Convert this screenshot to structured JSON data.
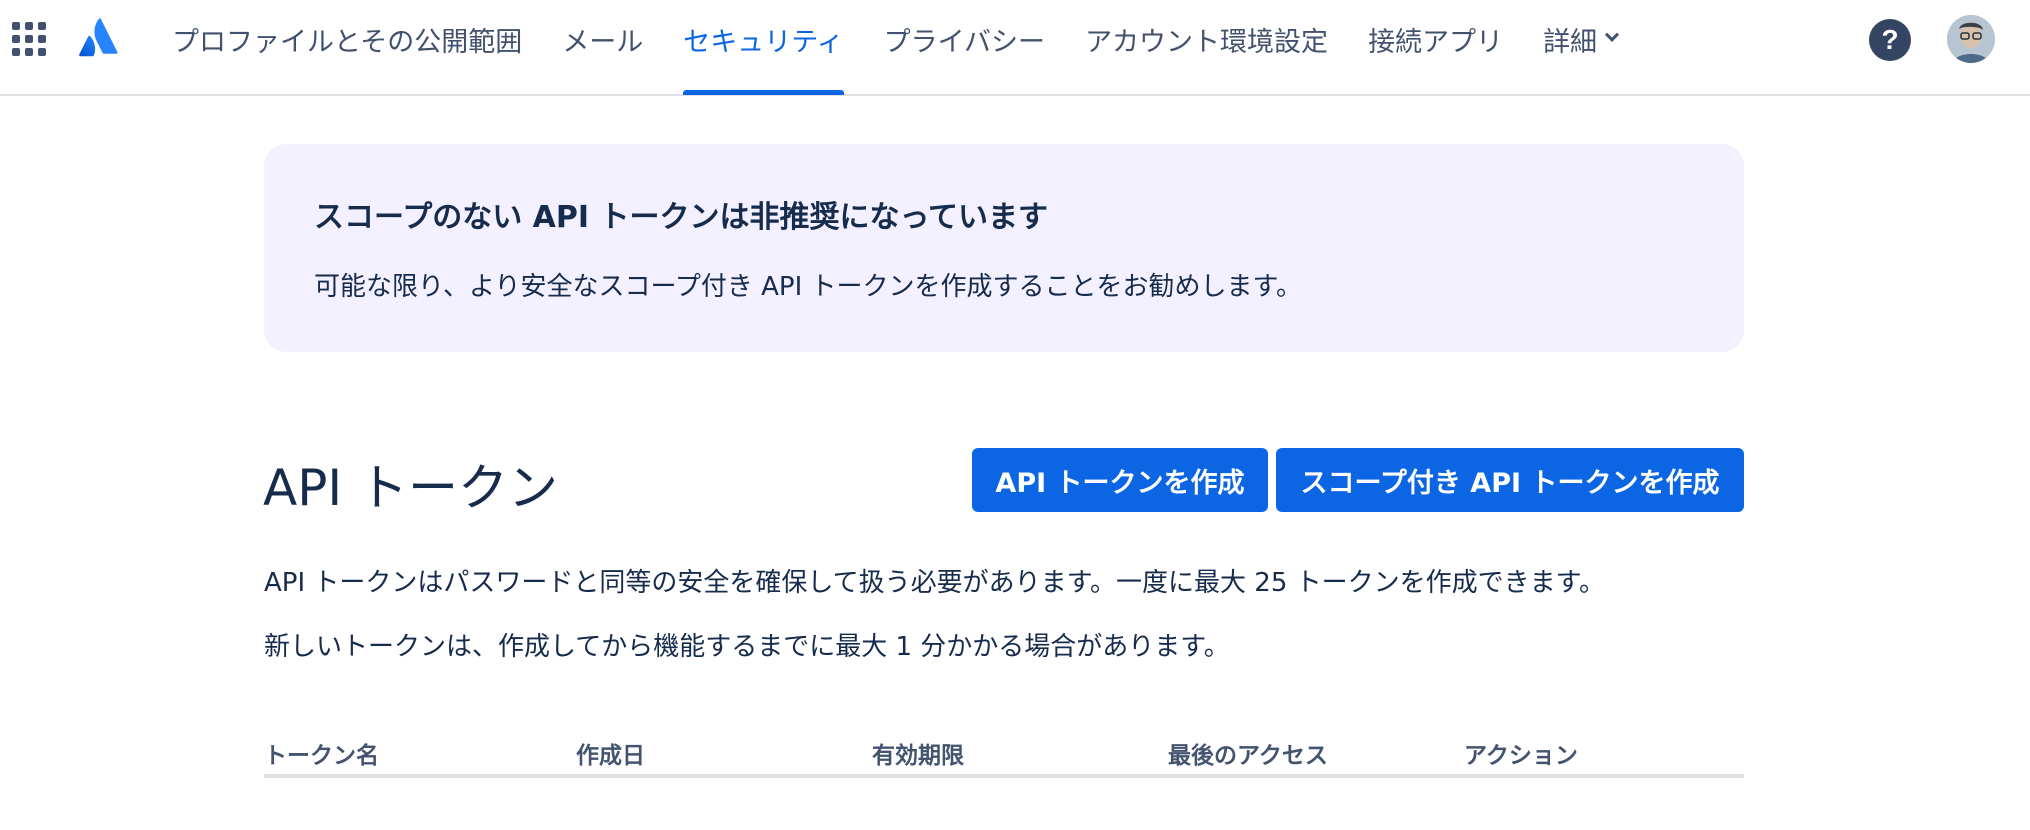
{
  "nav": {
    "items": [
      {
        "label": "プロファイルとその公開範囲"
      },
      {
        "label": "メール"
      },
      {
        "label": "セキュリティ"
      },
      {
        "label": "プライバシー"
      },
      {
        "label": "アカウント環境設定"
      },
      {
        "label": "接続アプリ"
      },
      {
        "label": "詳細"
      }
    ],
    "active_index": 2,
    "help_label": "?"
  },
  "notice": {
    "title": "スコープのない API トークンは非推奨になっています",
    "body": "可能な限り、より安全なスコープ付き API トークンを作成することをお勧めします。"
  },
  "section": {
    "title": "API トークン",
    "create_button": "API トークンを作成",
    "create_scoped_button": "スコープ付き API トークンを作成",
    "description_1": "API トークンはパスワードと同等の安全を確保して扱う必要があります。一度に最大 25 トークンを作成できます。",
    "description_2": "新しいトークンは、作成してから機能するまでに最大 1 分かかる場合があります。"
  },
  "table": {
    "columns": [
      "トークン名",
      "作成日",
      "有効期限",
      "最後のアクセス",
      "アクション"
    ]
  },
  "colors": {
    "accent": "#0c66e4",
    "text": "#172b4d",
    "subtle_text": "#42526e",
    "notice_bg": "#f3f0ff",
    "border": "#dfe1e6"
  },
  "icons": {
    "app_switcher": "grid-icon",
    "logo": "atlassian-logo",
    "help": "help-icon",
    "more_chevron": "chevron-down-icon"
  }
}
